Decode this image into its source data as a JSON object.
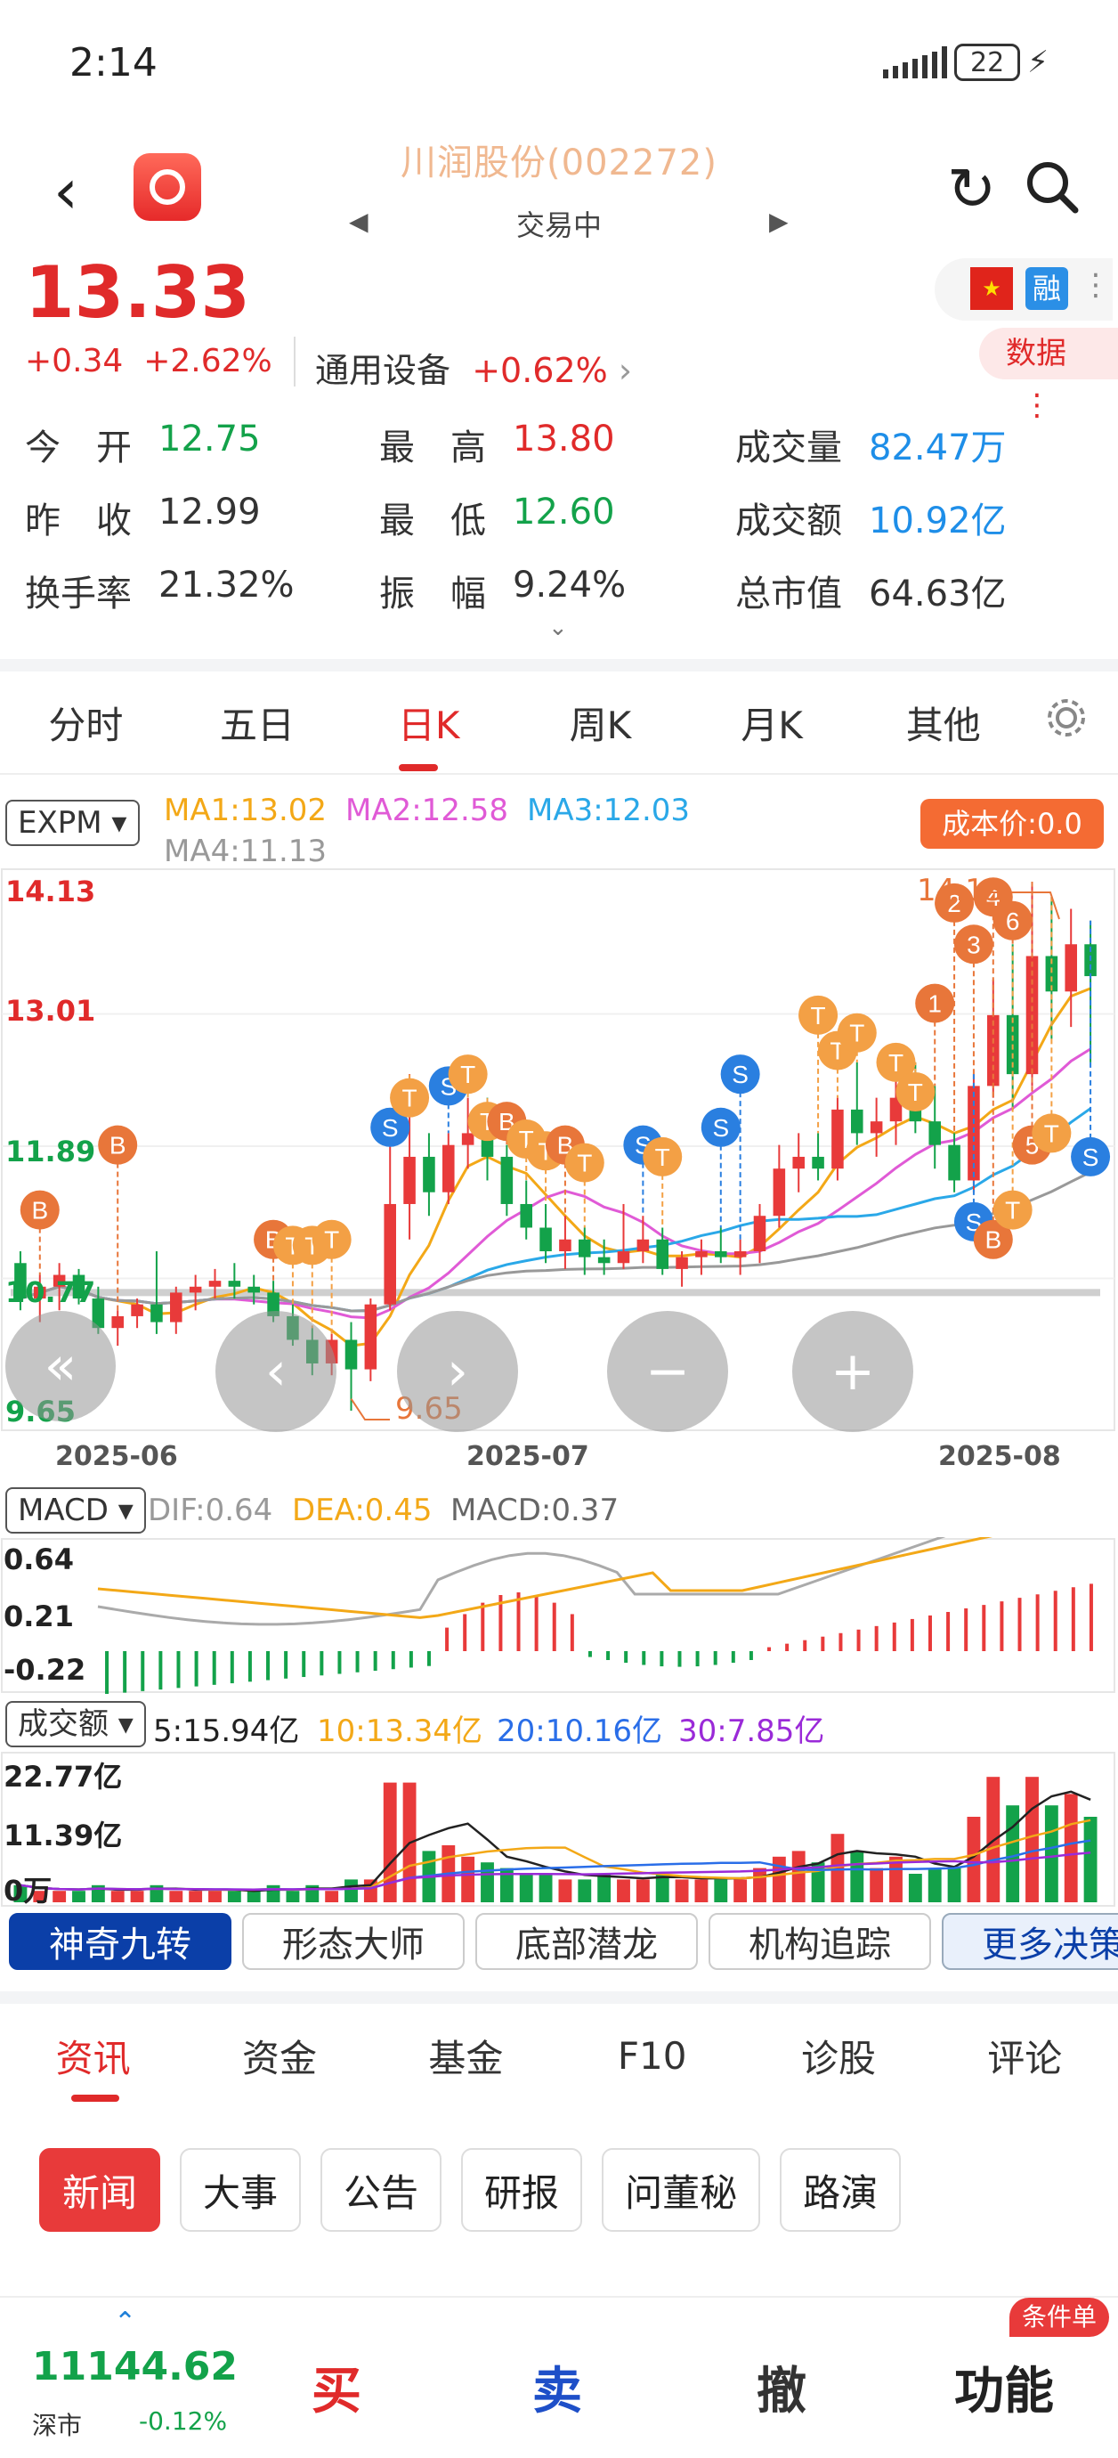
{
  "status": {
    "time": "2:14",
    "battery": "22"
  },
  "header": {
    "title": "川润股份(002272)",
    "subtitle": "交易中"
  },
  "quote": {
    "price": "13.33",
    "change": "+0.34",
    "change_pct": "+2.62%",
    "sector": "通用设备",
    "sector_pct": "+0.62%",
    "badge_rong": "融",
    "data_btn": "数据"
  },
  "stats": [
    {
      "label": "今　开",
      "value": "12.75",
      "color": "green"
    },
    {
      "label": "最　高",
      "value": "13.80",
      "color": "red"
    },
    {
      "label": "成交量",
      "value": "82.47万",
      "color": "blue"
    },
    {
      "label": "昨　收",
      "value": "12.99",
      "color": "dark"
    },
    {
      "label": "最　低",
      "value": "12.60",
      "color": "green"
    },
    {
      "label": "成交额",
      "value": "10.92亿",
      "color": "blue"
    },
    {
      "label": "换手率",
      "value": "21.32%",
      "color": "dark"
    },
    {
      "label": "振　幅",
      "value": "9.24%",
      "color": "dark"
    },
    {
      "label": "总市值",
      "value": "64.63亿",
      "color": "dark"
    }
  ],
  "chart_tabs": [
    "分时",
    "五日",
    "日K",
    "周K",
    "月K",
    "其他"
  ],
  "kline": {
    "indicator": "EXPM",
    "ma1": "MA1:13.02",
    "ma2": "MA2:12.58",
    "ma3": "MA3:12.03",
    "ma4": "MA4:11.13",
    "cost": "成本价:0.0",
    "y_labels": [
      "14.13",
      "13.01",
      "11.89",
      "10.77",
      "9.65"
    ],
    "high_label": "14.13",
    "low_label": "9.65",
    "x_labels": [
      "2025-06",
      "2025-07",
      "2025-08"
    ]
  },
  "macd": {
    "name": "MACD",
    "dif": "DIF:0.64",
    "dea": "DEA:0.45",
    "macd": "MACD:0.37",
    "y_labels": [
      "0.64",
      "0.21",
      "-0.22"
    ]
  },
  "volume": {
    "name": "成交额",
    "ma5": "5:15.94亿",
    "ma10": "10:13.34亿",
    "ma20": "20:10.16亿",
    "ma30": "30:7.85亿",
    "y_labels": [
      "22.77亿",
      "11.39亿",
      "0万"
    ]
  },
  "strategy_tabs": [
    "神奇九转",
    "形态大师",
    "底部潜龙",
    "机构追踪",
    "更多决策"
  ],
  "info_tabs": [
    "资讯",
    "资金",
    "基金",
    "F10",
    "诊股",
    "评论"
  ],
  "info_chips": [
    "新闻",
    "大事",
    "公告",
    "研报",
    "问董秘",
    "路演"
  ],
  "bottom": {
    "index_value": "11144.62",
    "index_name": "深市",
    "index_pct": "-0.12%",
    "buy": "买",
    "sell": "卖",
    "cancel": "撤",
    "func": "功能",
    "cond": "条件单"
  },
  "chart_data": {
    "type": "candlestick",
    "title": "",
    "x": [
      "2025-06",
      "2025-07",
      "2025-08"
    ],
    "ylim": [
      9.65,
      14.13
    ],
    "ohlc": [
      [
        10.9,
        11.0,
        10.5,
        10.6
      ],
      [
        10.6,
        10.8,
        10.4,
        10.7
      ],
      [
        10.7,
        10.9,
        10.5,
        10.8
      ],
      [
        10.8,
        10.85,
        10.55,
        10.6
      ],
      [
        10.6,
        10.7,
        10.3,
        10.35
      ],
      [
        10.35,
        10.5,
        10.2,
        10.45
      ],
      [
        10.45,
        10.6,
        10.35,
        10.55
      ],
      [
        10.55,
        11.0,
        10.3,
        10.4
      ],
      [
        10.4,
        10.7,
        10.3,
        10.65
      ],
      [
        10.65,
        10.8,
        10.5,
        10.7
      ],
      [
        10.7,
        10.85,
        10.6,
        10.75
      ],
      [
        10.75,
        10.9,
        10.6,
        10.7
      ],
      [
        10.7,
        10.8,
        10.55,
        10.65
      ],
      [
        10.65,
        10.75,
        10.4,
        10.45
      ],
      [
        10.45,
        10.55,
        10.2,
        10.25
      ],
      [
        10.25,
        10.35,
        9.95,
        10.05
      ],
      [
        10.05,
        10.3,
        9.95,
        10.25
      ],
      [
        10.25,
        10.4,
        9.65,
        10.0
      ],
      [
        10.0,
        10.6,
        9.9,
        10.55
      ],
      [
        10.55,
        11.9,
        10.5,
        11.4
      ],
      [
        11.4,
        12.5,
        11.1,
        11.8
      ],
      [
        11.8,
        12.0,
        11.3,
        11.5
      ],
      [
        11.5,
        12.0,
        11.4,
        11.9
      ],
      [
        11.9,
        12.3,
        11.7,
        12.0
      ],
      [
        12.0,
        12.3,
        11.6,
        11.8
      ],
      [
        11.8,
        11.9,
        11.3,
        11.4
      ],
      [
        11.4,
        11.6,
        11.1,
        11.2
      ],
      [
        11.2,
        11.4,
        10.9,
        11.0
      ],
      [
        11.0,
        11.3,
        10.85,
        11.1
      ],
      [
        11.1,
        11.2,
        10.8,
        10.95
      ],
      [
        10.95,
        11.1,
        10.8,
        10.9
      ],
      [
        10.9,
        11.4,
        10.85,
        11.0
      ],
      [
        11.0,
        11.3,
        10.9,
        11.1
      ],
      [
        11.1,
        11.2,
        10.8,
        10.85
      ],
      [
        10.85,
        11.0,
        10.7,
        10.95
      ],
      [
        10.95,
        11.1,
        10.8,
        11.0
      ],
      [
        11.0,
        11.2,
        10.9,
        10.95
      ],
      [
        10.95,
        11.1,
        10.8,
        11.0
      ],
      [
        11.0,
        11.4,
        10.9,
        11.3
      ],
      [
        11.3,
        11.9,
        11.2,
        11.7
      ],
      [
        11.7,
        12.0,
        11.5,
        11.8
      ],
      [
        11.8,
        12.0,
        11.6,
        11.7
      ],
      [
        11.7,
        12.3,
        11.6,
        12.2
      ],
      [
        12.2,
        12.6,
        11.9,
        12.0
      ],
      [
        12.0,
        12.3,
        11.8,
        12.1
      ],
      [
        12.1,
        12.5,
        11.9,
        12.3
      ],
      [
        12.3,
        12.6,
        12.0,
        12.1
      ],
      [
        12.1,
        12.4,
        11.7,
        11.9
      ],
      [
        11.9,
        12.0,
        11.5,
        11.6
      ],
      [
        11.6,
        12.5,
        11.5,
        12.4
      ],
      [
        12.4,
        13.3,
        12.3,
        13.0
      ],
      [
        13.0,
        13.6,
        12.2,
        12.5
      ],
      [
        12.5,
        14.13,
        12.4,
        13.5
      ],
      [
        13.5,
        14.0,
        12.8,
        13.2
      ],
      [
        13.2,
        13.9,
        12.9,
        13.6
      ],
      [
        13.6,
        13.8,
        12.6,
        13.33
      ]
    ]
  }
}
